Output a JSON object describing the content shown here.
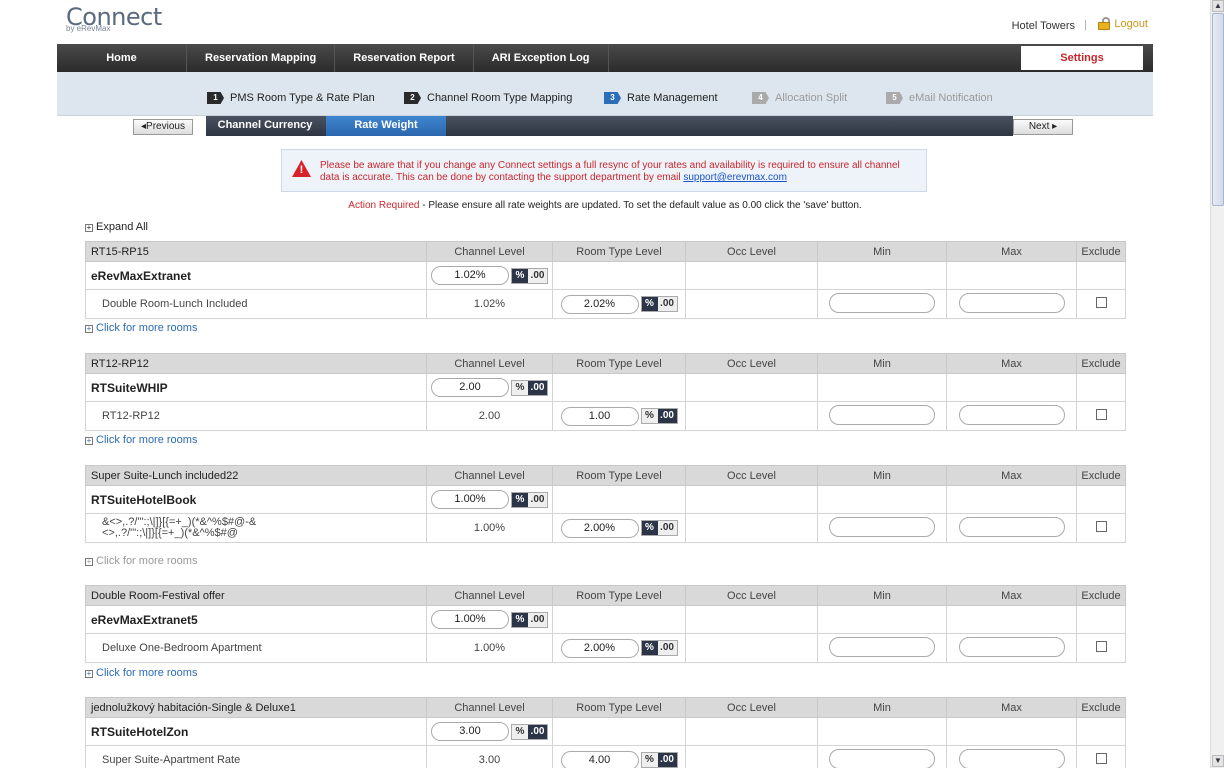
{
  "header": {
    "logo": "Connect",
    "logo_sub": "by eRevMax",
    "hotel_name": "Hotel Towers",
    "separator": "|",
    "logout": "Logout"
  },
  "nav": {
    "items": [
      "Home",
      "Reservation Mapping",
      "Reservation Report",
      "ARI Exception Log"
    ],
    "settings": "Settings"
  },
  "steps": [
    {
      "num": "1",
      "label": "PMS Room Type & Rate Plan",
      "state": "normal"
    },
    {
      "num": "2",
      "label": "Channel Room Type Mapping",
      "state": "normal"
    },
    {
      "num": "3",
      "label": "Rate Management",
      "state": "active"
    },
    {
      "num": "4",
      "label": "Allocation Split",
      "state": "disabled"
    },
    {
      "num": "5",
      "label": "eMail Notification",
      "state": "disabled"
    }
  ],
  "subtabs": {
    "prev": "◂Previous",
    "next": "Next ▸",
    "channel_currency": "Channel Currency",
    "rate_weight": "Rate Weight"
  },
  "warning": {
    "icon": "!",
    "text": "Please be aware that if you change any Connect settings a full resync of your rates and availability is required to ensure all channel data is accurate. This can be done by contacting the support department by email",
    "email": "support@erevmax.com"
  },
  "action": {
    "required": "Action Required",
    "text": " - Please ensure all rate weights are updated. To set the default value as 0.00 click the 'save' button."
  },
  "expand_all": "Expand All",
  "columns": [
    "Channel Level",
    "Room Type Level",
    "Occ Level",
    "Min",
    "Max",
    "Exclude"
  ],
  "groups": [
    {
      "title": "RT15-RP15",
      "channel": "eRevMaxExtranet",
      "channel_value": "1.02%",
      "channel_mode": "pct",
      "room": "Double Room-Lunch Included",
      "room_channel": "1.02%",
      "room_value": "2.02%",
      "room_mode": "pct",
      "more": "Click for more rooms",
      "more_dim": false
    },
    {
      "title": "RT12-RP12",
      "channel": "RTSuiteWHIP",
      "channel_value": "2.00",
      "channel_mode": "dec",
      "room": "RT12-RP12",
      "room_channel": "2.00",
      "room_value": "1.00",
      "room_mode": "dec",
      "more": "Click for more rooms",
      "more_dim": false
    },
    {
      "title": "Super Suite-Lunch included22",
      "channel": "RTSuiteHotelBook",
      "channel_value": "1.00%",
      "channel_mode": "pct",
      "room": "&<>,.?/'\":;\\|]}[{=+_)(*&^%$#@-&",
      "room2": "<>,.?/'\":;\\|]}[{=+_)(*&^%$#@",
      "room_channel": "1.00%",
      "room_value": "2.00%",
      "room_mode": "pct",
      "more": "Click for more rooms",
      "more_dim": true
    },
    {
      "title": "Double Room-Festival offer",
      "channel": "eRevMaxExtranet5",
      "channel_value": "1.00%",
      "channel_mode": "pct",
      "room": "Deluxe One-Bedroom Apartment",
      "room_channel": "1.00%",
      "room_value": "2.00%",
      "room_mode": "pct",
      "more": "Click for more rooms",
      "more_dim": false
    },
    {
      "title": "jednolužkový habitación-Single & Deluxe1",
      "channel": "RTSuiteHotelZon",
      "channel_value": "3.00",
      "channel_mode": "dec",
      "room": "Super Suite-Apartment Rate",
      "room_channel": "3.00",
      "room_value": "4.00",
      "room_mode": "dec",
      "more": "",
      "more_dim": false
    }
  ],
  "toggle": {
    "pct": "%",
    "dec": ".00"
  }
}
